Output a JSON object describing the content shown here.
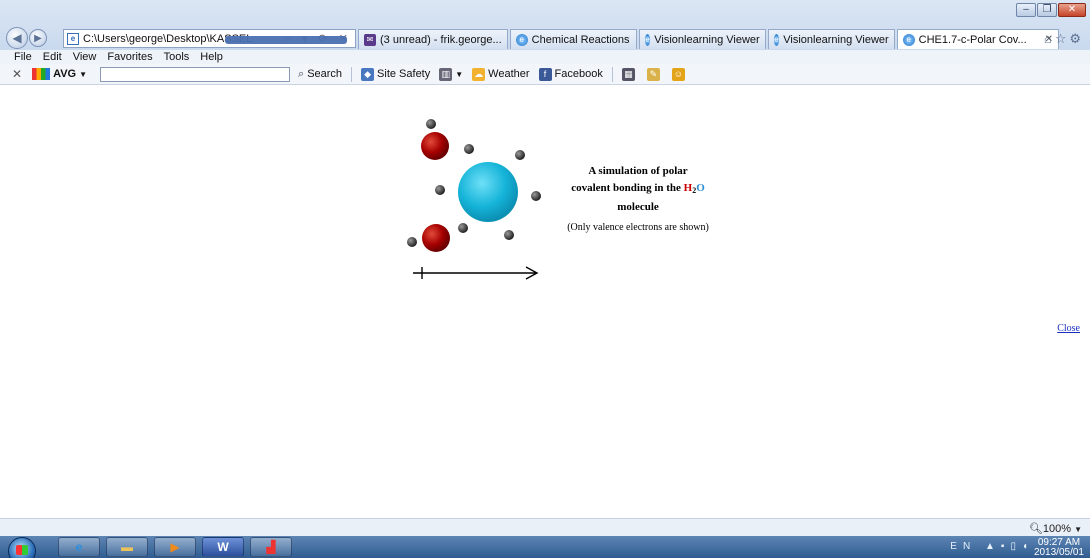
{
  "browser": {
    "address_url": "C:\\Users\\george\\Desktop\\KASSEL",
    "tabs": [
      {
        "label": "(3 unread) - frik.george...",
        "icon": "mail-icon"
      },
      {
        "label": "Chemical Reactions",
        "icon": "ie-icon"
      },
      {
        "label": "Visionlearning Viewer",
        "icon": "ie-icon"
      },
      {
        "label": "Visionlearning Viewer",
        "icon": "ie-icon"
      },
      {
        "label": "CHE1.7-c-Polar Cov...",
        "icon": "ie-icon",
        "active": true
      }
    ]
  },
  "menu": [
    "File",
    "Edit",
    "View",
    "Favorites",
    "Tools",
    "Help"
  ],
  "toolbar": {
    "avg": "AVG",
    "search": "Search",
    "site_safety": "Site Safety",
    "weather": "Weather",
    "facebook": "Facebook"
  },
  "content": {
    "caption_line1": "A simulation of polar",
    "caption_line2_pre": "covalent bonding in the ",
    "caption_h": "H",
    "caption_sub": "2",
    "caption_o": "O",
    "caption_line3": "molecule",
    "note": "(Only valence electrons are shown)",
    "close": "Close"
  },
  "colors": {
    "oxygen": "#1ab5da",
    "hydrogen": "#a80000",
    "electron": "#333333",
    "h_text": "#cc0000",
    "o_text": "#2a8fd6",
    "link": "#1a2ec0"
  },
  "status": {
    "zoom": "100%"
  },
  "taskbar": {
    "language": "EN",
    "time": "09:27 AM",
    "date": "2013/05/01"
  }
}
